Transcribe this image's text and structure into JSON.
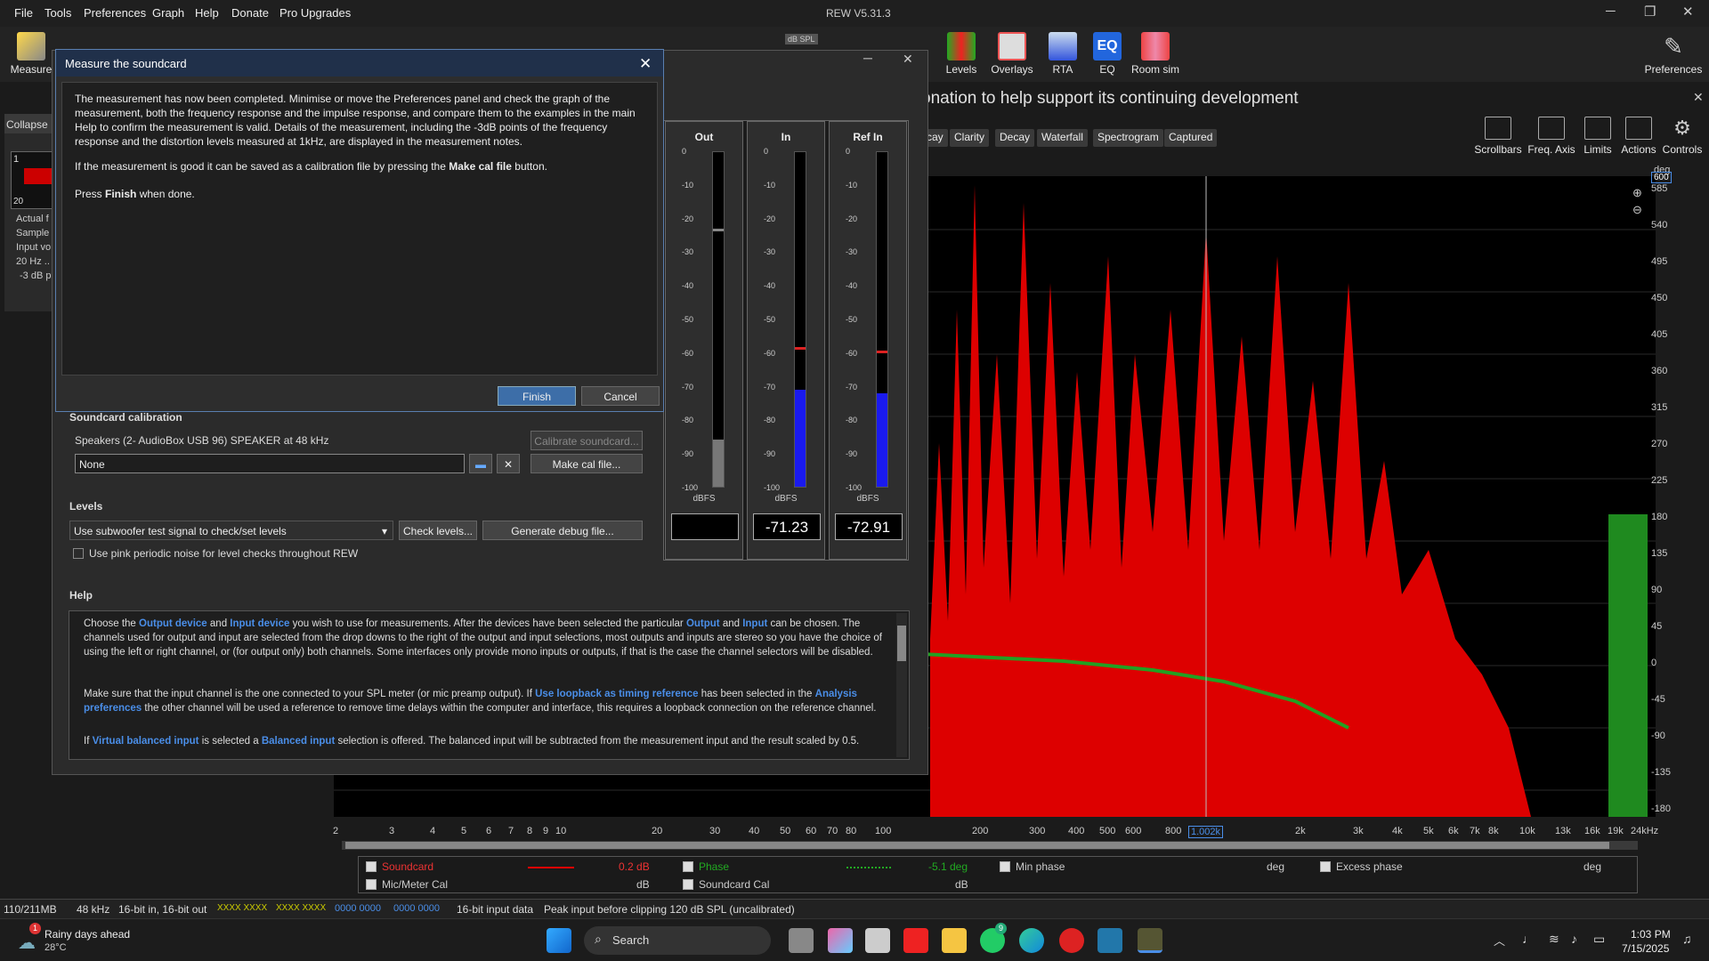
{
  "app": {
    "title": "REW V5.31.3",
    "menus": [
      "File",
      "Tools",
      "Preferences",
      "Graph",
      "Help",
      "Donate",
      "Pro Upgrades"
    ]
  },
  "toolbar": {
    "measure": "Measure",
    "levels": "Levels",
    "overlays": "Overlays",
    "rta": "RTA",
    "eq": "EQ",
    "roomsim": "Room sim",
    "preferences": "Preferences",
    "spl_badge": "dB SPL"
  },
  "donate_banner": "onation to help support its continuing development",
  "graph_tabs": [
    "cay",
    "Clarity",
    "Decay",
    "Waterfall",
    "Spectrogram",
    "Captured"
  ],
  "graph_controls": [
    "Scrollbars",
    "Freq. Axis",
    "Limits",
    "Actions",
    "Controls"
  ],
  "y_unit": "deg",
  "y_top_box": "600",
  "y_labels": [
    "585",
    "540",
    "495",
    "450",
    "405",
    "360",
    "315",
    "270",
    "225",
    "180",
    "135",
    "90",
    "45",
    "0",
    "-45",
    "-90",
    "-135",
    "-180"
  ],
  "x_labels": [
    "2",
    "3",
    "4",
    "5",
    "6",
    "7",
    "8",
    "9",
    "10",
    "20",
    "30",
    "40",
    "50",
    "60",
    "70",
    "80",
    "100",
    "200",
    "300",
    "400",
    "500",
    "600",
    "800",
    "1.002k",
    "2k",
    "3k",
    "4k",
    "5k",
    "6k",
    "7k",
    "8k",
    "10k",
    "13k",
    "16k",
    "19k",
    "24kHz"
  ],
  "left_panel": {
    "collapse": "Collapse",
    "num1": "1",
    "num2": "20",
    "lines": [
      "Actual f",
      "Sample",
      "Input vo",
      "20 Hz ..",
      "-3 dB p"
    ]
  },
  "modal": {
    "title": "Measure the soundcard",
    "p1": "The measurement has now been completed. Minimise or move the Preferences panel and check the graph of the measurement, both the frequency response and the impulse response, and compare them to the examples in the main Help to confirm the measurement is valid. Details of the measurement, including the -3dB points of the frequency response and the distortion levels measured at 1kHz, are displayed in the measurement notes.",
    "p2a": "If the measurement is good it can be saved as a calibration file by pressing the ",
    "p2b": "Make cal file",
    "p2c": " button.",
    "p3a": "Press ",
    "p3b": "Finish",
    "p3c": " when done.",
    "finish": "Finish",
    "cancel": "Cancel"
  },
  "meters": {
    "scale": [
      "0",
      "-10",
      "-20",
      "-30",
      "-40",
      "-50",
      "-60",
      "-70",
      "-80",
      "-90",
      "-100"
    ],
    "unit": "dBFS",
    "items": [
      {
        "title": "Out",
        "reading": "",
        "level": 0.14,
        "peak": null
      },
      {
        "title": "In",
        "reading": "-71.23",
        "level": 0.29,
        "peak": 0.41
      },
      {
        "title": "Ref In",
        "reading": "-72.91",
        "level": 0.28,
        "peak": 0.4
      }
    ]
  },
  "soundcard": {
    "section": "Soundcard calibration",
    "device": "Speakers (2- AudioBox USB 96) SPEAKER at 48 kHz",
    "calibrate": "Calibrate soundcard...",
    "cal_file": "None",
    "make_cal": "Make cal file..."
  },
  "levels": {
    "section": "Levels",
    "select": "Use subwoofer test signal to check/set levels",
    "check": "Check levels...",
    "debug": "Generate debug file...",
    "pink": "Use pink periodic noise for level checks throughout REW"
  },
  "help": {
    "section": "Help"
  },
  "legend": {
    "soundcard": "Soundcard",
    "soundcard_val": "0.2 dB",
    "phase": "Phase",
    "phase_val": "-5.1 deg",
    "minphase": "Min phase",
    "deg": "deg",
    "excess": "Excess phase",
    "mic": "Mic/Meter Cal",
    "db": "dB",
    "sccal": "Soundcard Cal"
  },
  "status": {
    "mem": "110/211MB",
    "rate": "48 kHz",
    "bits": "16-bit in, 16-bit out",
    "x1": "XXXX XXXX",
    "x2": "XXXX XXXX",
    "z1": "0000 0000",
    "z2": "0000 0000",
    "input": "16-bit input data",
    "peak": "Peak input before clipping 120 dB SPL (uncalibrated)"
  },
  "taskbar": {
    "weather": "Rainy days ahead",
    "temp": "28°C",
    "search": "Search",
    "time": "1:03 PM",
    "date": "7/15/2025",
    "badge": "1",
    "wa_badge": "9"
  },
  "colors": {
    "accent": "#4a8ee8",
    "trace": "#e00000",
    "phase": "#1a9a1a"
  }
}
